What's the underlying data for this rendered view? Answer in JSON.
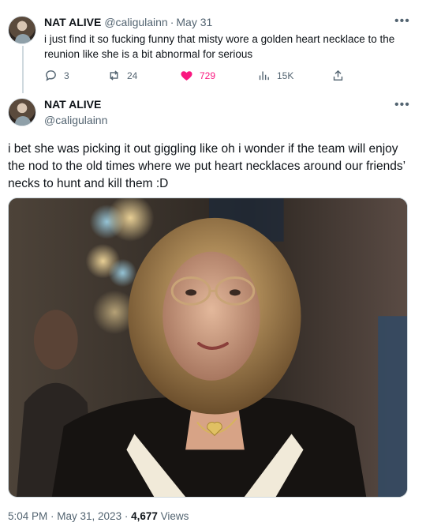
{
  "reply": {
    "display_name": "NAT ALIVE",
    "handle": "@caligulainn",
    "separator": "·",
    "date": "May 31",
    "more_label": "•••",
    "text": "i just find it so fucking funny that misty wore a golden heart necklace to the reunion like she is a bit abnormal for serious",
    "stats": {
      "replies": "3",
      "retweets": "24",
      "likes": "729",
      "views": "15K"
    }
  },
  "main": {
    "display_name": "NAT ALIVE",
    "handle": "@caligulainn",
    "more_label": "•••",
    "text": "i bet she was picking it out giggling like oh i wonder if the team will enjoy the nod to the old times where we put heart necklaces around our friends’ necks to hunt and kill them :D",
    "timestamp": "5:04 PM · May 31, 2023 · ",
    "views_count": "4,677",
    "views_label": " Views"
  },
  "colors": {
    "text": "#0f1419",
    "secondary": "#536471",
    "like": "#f91880",
    "divider": "#cfd9de"
  },
  "icons": [
    "reply-icon",
    "retweet-icon",
    "heart-icon",
    "views-icon",
    "share-icon",
    "more-icon"
  ]
}
